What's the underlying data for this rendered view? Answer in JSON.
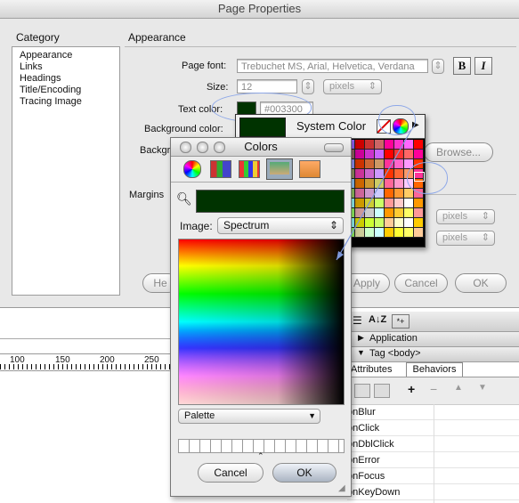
{
  "dialog": {
    "title": "Page Properties",
    "category_header": "Category",
    "categories": [
      "Appearance",
      "Links",
      "Headings",
      "Title/Encoding",
      "Tracing Image"
    ],
    "section_title": "Appearance",
    "page_font_label": "Page font:",
    "page_font_value": "Trebuchet MS, Arial, Helvetica, Verdana",
    "bold_label": "B",
    "italic_label": "I",
    "size_label": "Size:",
    "size_value": "12",
    "size_unit": "pixels",
    "text_color_label": "Text color:",
    "text_color_value": "#003300",
    "bg_color_label": "Background color:",
    "bg_image_label": "Backgr",
    "browse_label": "Browse...",
    "margins_label": "Margins",
    "margin_unit_1": "pixels",
    "margin_unit_2": "pixels",
    "help_label": "He",
    "apply_label": "Apply",
    "cancel_label": "Cancel",
    "ok_label": "OK"
  },
  "swatch_picker": {
    "title": "System Color",
    "selected_color": "#003300"
  },
  "colors_panel": {
    "title": "Colors",
    "current_color": "#003300",
    "image_label": "Image:",
    "image_select": "Spectrum",
    "palette_select": "Palette",
    "cancel_label": "Cancel",
    "ok_label": "OK"
  },
  "ruler": {
    "ticks": [
      "100",
      "150",
      "200",
      "250"
    ]
  },
  "tag_panel": {
    "application_label": "Application",
    "tag_label": "Tag <body>",
    "tab_attributes": "Attributes",
    "tab_behaviors": "Behaviors",
    "add_label": "+",
    "remove_label": "−",
    "events": [
      "onBlur",
      "onClick",
      "onDblClick",
      "onError",
      "onFocus",
      "onKeyDown"
    ]
  },
  "colors": {
    "text_color": "#003300",
    "accent_blue": "#6c8fd9"
  }
}
